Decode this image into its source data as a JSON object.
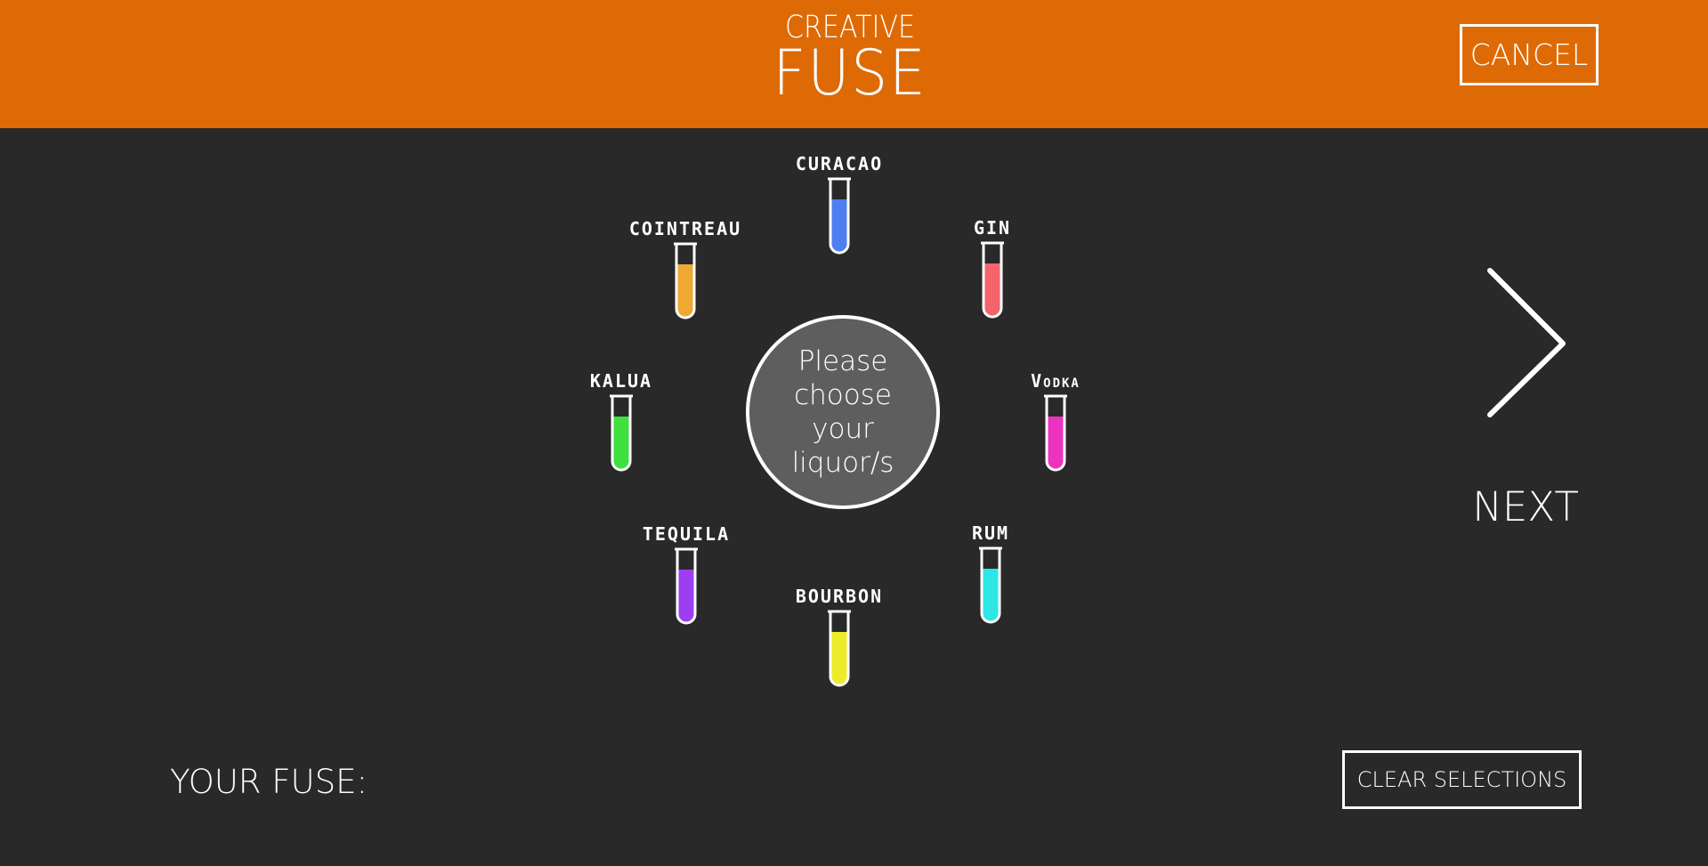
{
  "header": {
    "logo_top": "CREATIVE",
    "logo_bottom": "FUSE",
    "cancel_label": "CANCEL",
    "background_color": "#de6a06"
  },
  "liquors": [
    {
      "label": "CURACAO",
      "color": "#4f7ef0"
    },
    {
      "label": "GIN",
      "color": "#f5636b"
    },
    {
      "label": "VODKA",
      "color": "#ec33c0"
    },
    {
      "label": "RUM",
      "color": "#2ee6e6"
    },
    {
      "label": "BOURBON",
      "color": "#ecec2b"
    },
    {
      "label": "TEQUILA",
      "color": "#9d3ef2"
    },
    {
      "label": "KALUA",
      "color": "#3fe03f"
    },
    {
      "label": "COINTREAU",
      "color": "#eea834"
    }
  ],
  "center": {
    "prompt": "Please choose your liquor/s"
  },
  "navigation": {
    "next_label": "NEXT",
    "next_icon": "chevron-right-icon"
  },
  "footer": {
    "your_fuse_label": "YOUR FUSE:",
    "clear_label": "CLEAR SELECTIONS"
  }
}
